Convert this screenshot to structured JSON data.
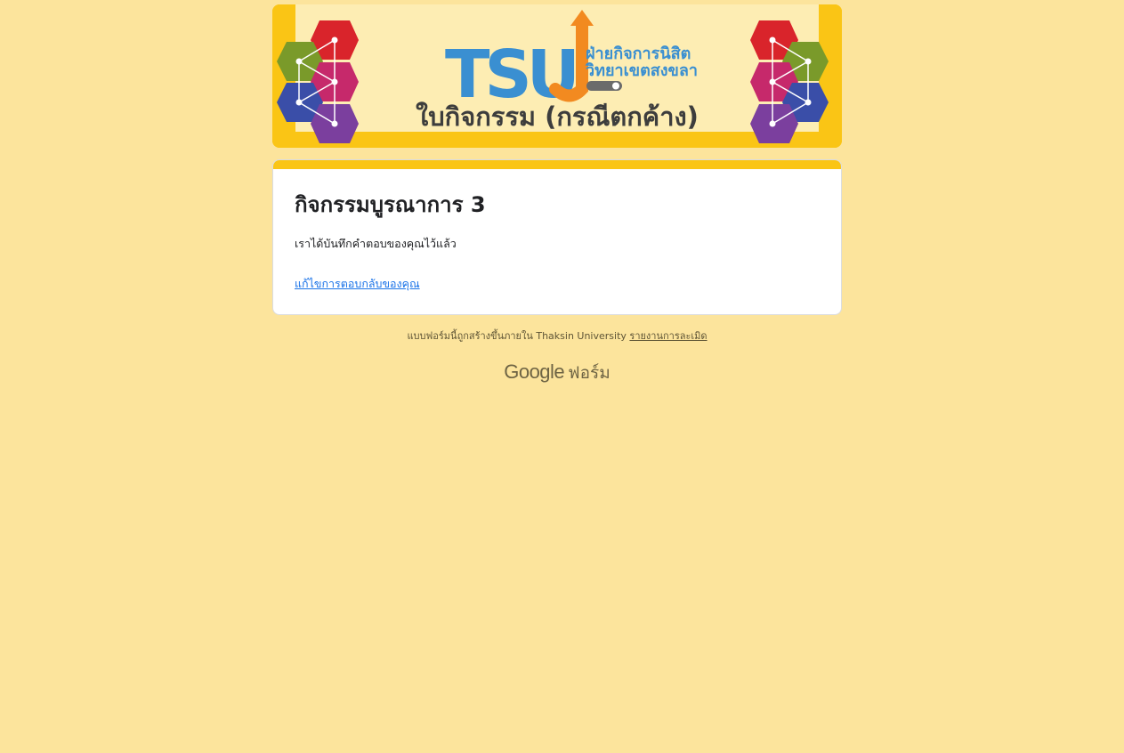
{
  "banner": {
    "logo_text": "TSU",
    "org_line1": "ฝ่ายกิจการนิสิต",
    "org_line2": "วิทยาเขตสงขลา",
    "caption": "ใบกิจกรรม (กรณีตกค้าง)"
  },
  "form": {
    "title": "กิจกรรมบูรณาการ 3",
    "confirmation": "เราได้บันทึกคำตอบของคุณไว้แล้ว",
    "edit_link": "แก้ไขการตอบกลับของคุณ"
  },
  "footer": {
    "created_text": "แบบฟอร์มนี้ถูกสร้างขึ้นภายใน Thaksin University",
    "report_link": "รายงานการละเมิด",
    "brand_google": "Google",
    "brand_forms": "ฟอร์ม"
  },
  "colors": {
    "page_bg": "#fce49c",
    "accent": "#fac515",
    "link": "#1a73e8"
  }
}
